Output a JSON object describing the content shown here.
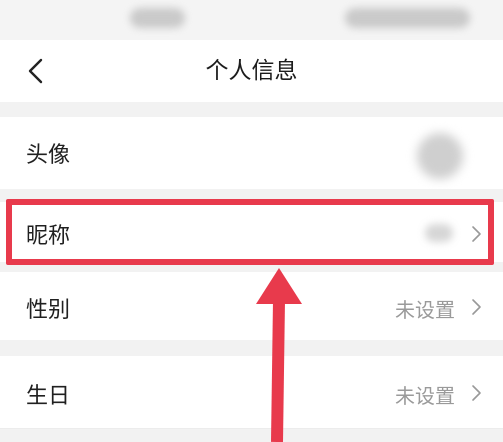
{
  "header": {
    "title": "个人信息"
  },
  "rows": [
    {
      "label": "头像",
      "value": ""
    },
    {
      "label": "昵称",
      "value": ""
    },
    {
      "label": "性别",
      "value": "未设置"
    },
    {
      "label": "生日",
      "value": "未设置"
    }
  ],
  "colors": {
    "highlight": "#e83a4c",
    "background": "#f2f2f2",
    "value_text": "#9a9a9a"
  },
  "icons": {
    "back": "chevron-left-icon",
    "row": "chevron-right-icon"
  }
}
